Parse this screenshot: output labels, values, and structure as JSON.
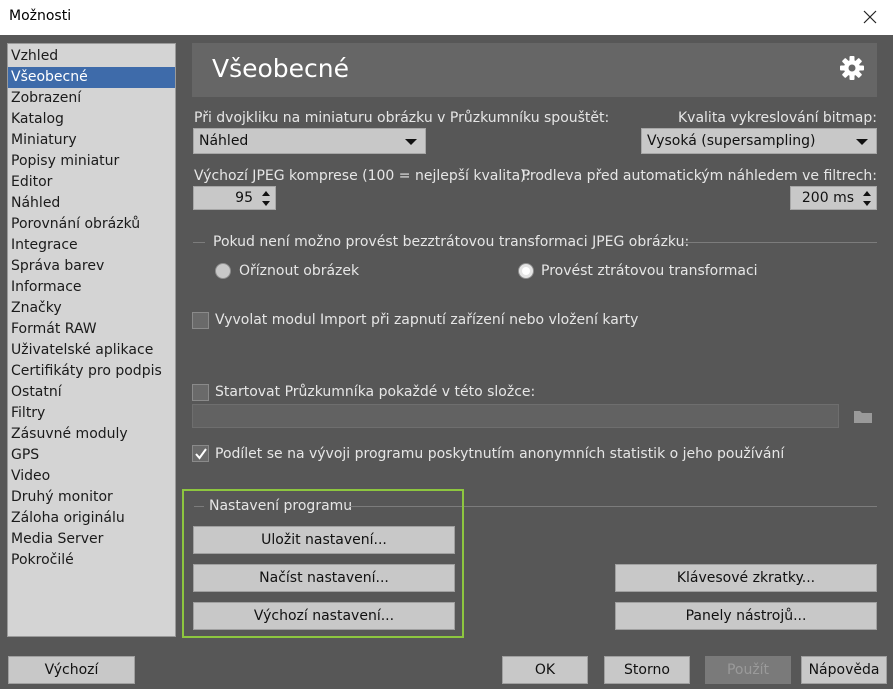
{
  "window": {
    "title": "Možnosti"
  },
  "sidebar": {
    "items": [
      "Vzhled",
      "Všeobecné",
      "Zobrazení",
      "Katalog",
      "Miniatury",
      "Popisy miniatur",
      "Editor",
      "Náhled",
      "Porovnání obrázků",
      "Integrace",
      "Správa barev",
      "Informace",
      "Značky",
      "Formát RAW",
      "Uživatelské aplikace",
      "Certifikáty pro podpis",
      "Ostatní",
      "Filtry",
      "Zásuvné moduly",
      "GPS",
      "Video",
      "Druhý monitor",
      "Záloha originálu",
      "Media Server",
      "Pokročilé"
    ],
    "selected": "Všeobecné"
  },
  "header": {
    "title": "Všeobecné"
  },
  "general": {
    "dblclick_label": "Při dvojkliku na miniaturu obrázku v Průzkumníku spouštět:",
    "dblclick_value": "Náhled",
    "bitmap_quality_label": "Kvalita vykreslování bitmap:",
    "bitmap_quality_value": "Vysoká (supersampling)",
    "jpeg_label": "Výchozí JPEG komprese (100 = nejlepší kvalita):",
    "jpeg_value": "95",
    "filter_delay_label": "Prodleva před automatickým náhledem ve filtrech:",
    "filter_delay_value": "200 ms",
    "lossless_group_label": "Pokud není možno provést bezztrátovou transformaci JPEG obrázku:",
    "radio_crop": "Oříznout obrázek",
    "radio_lossy": "Provést ztrátovou transformaci",
    "import_checkbox": "Vyvolat modul Import při zapnutí zařízení nebo vložení karty",
    "startup_folder_checkbox": "Startovat Průzkumníka pokaždé v této složce:",
    "startup_folder_value": "",
    "stats_checkbox": "Podílet se na vývoji programu poskytnutím anonymních statistik o jeho používání"
  },
  "settings_group": {
    "label": "Nastavení programu",
    "save": "Uložit nastavení...",
    "load": "Načíst nastavení...",
    "defaults": "Výchozí nastavení...",
    "shortcuts": "Klávesové zkratky...",
    "toolbars": "Panely nástrojů..."
  },
  "footer": {
    "default": "Výchozí",
    "ok": "OK",
    "cancel": "Storno",
    "apply": "Použít",
    "help": "Nápověda"
  }
}
